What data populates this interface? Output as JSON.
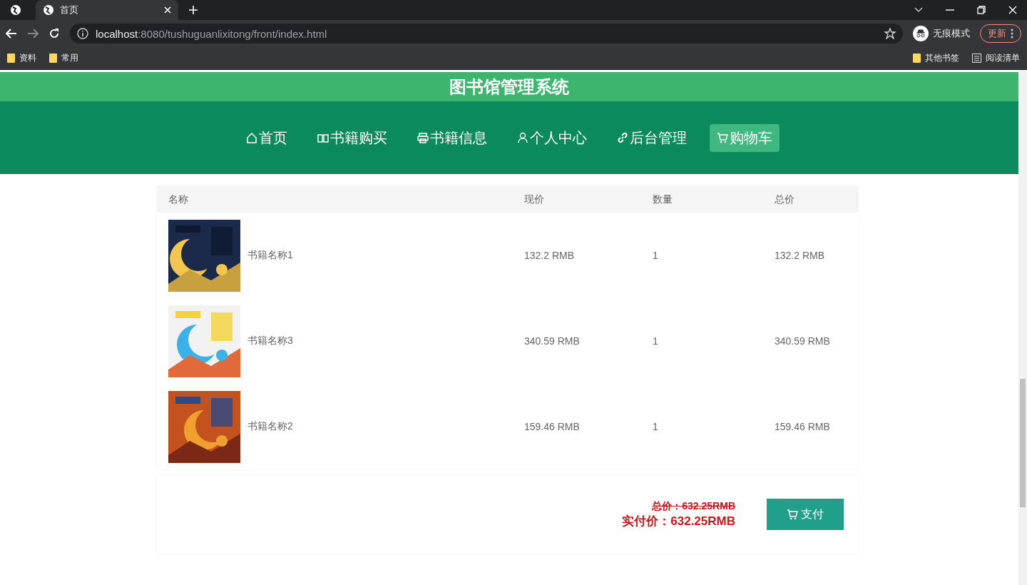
{
  "browser": {
    "tab_title": "首页",
    "url_host": "localhost",
    "url_path": ":8080/tushuguanlixitong/front/index.html",
    "incognito_label": "无痕模式",
    "update_button": "更新",
    "bookmarks": [
      "资料",
      "常用"
    ],
    "other_bookmarks": "其他书签",
    "reading_list": "阅读清单"
  },
  "site_title": "图书馆管理系统",
  "nav": [
    {
      "label": "首页",
      "kind": "home",
      "selected": false
    },
    {
      "label": "书籍购买",
      "kind": "book",
      "selected": false
    },
    {
      "label": "书籍信息",
      "kind": "print",
      "selected": false
    },
    {
      "label": "个人中心",
      "kind": "user",
      "selected": false
    },
    {
      "label": "后台管理",
      "kind": "link",
      "selected": false
    },
    {
      "label": "购物车",
      "kind": "cart",
      "selected": true
    }
  ],
  "cart": {
    "columns": [
      "名称",
      "现价",
      "数量",
      "总价"
    ],
    "rows": [
      {
        "name": "书籍名称1",
        "price": "132.2 RMB",
        "quantity": "1",
        "total": "132.2 RMB"
      },
      {
        "name": "书籍名称3",
        "price": "340.59 RMB",
        "quantity": "1",
        "total": "340.59 RMB"
      },
      {
        "name": "书籍名称2",
        "price": "159.46 RMB",
        "quantity": "1",
        "total": "159.46 RMB"
      }
    ],
    "original_total": "总价：632.25RMB",
    "pay_total": "实付价：632.25RMB",
    "pay_button": "支付"
  }
}
